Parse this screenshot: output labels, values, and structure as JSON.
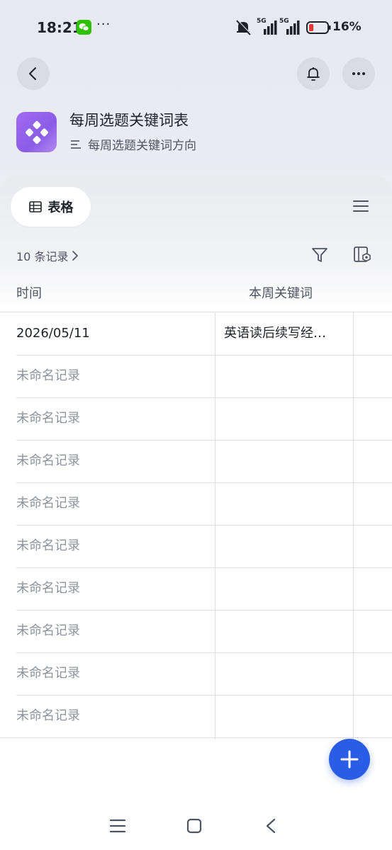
{
  "status_bar": {
    "time": "18:21",
    "more": "···",
    "signal_1_label": "5G",
    "signal_2_label": "5G",
    "battery_percent": "16%",
    "battery_level": 0.16,
    "icons": [
      "wechat-icon",
      "mute-icon",
      "signal-icon",
      "battery-icon"
    ]
  },
  "header": {
    "back_icon": "chevron-left-icon",
    "bell_icon": "bell-icon",
    "more_icon": "more-horizontal-icon",
    "app_title": "每周选题关键词表",
    "table_name": "每周选题关键词方向"
  },
  "toolbar": {
    "view_label": "表格",
    "record_count_label": "10 条记录",
    "menu_icon": "menu-icon",
    "filter_icon": "filter-icon",
    "settings_icon": "field-settings-icon"
  },
  "table": {
    "columns": [
      "时间",
      "本周关键词"
    ],
    "rows": [
      {
        "primary": "2026/05/11",
        "secondary": "英语读后续写经…",
        "named": true
      },
      {
        "primary": "未命名记录",
        "secondary": "",
        "named": false
      },
      {
        "primary": "未命名记录",
        "secondary": "",
        "named": false
      },
      {
        "primary": "未命名记录",
        "secondary": "",
        "named": false
      },
      {
        "primary": "未命名记录",
        "secondary": "",
        "named": false
      },
      {
        "primary": "未命名记录",
        "secondary": "",
        "named": false
      },
      {
        "primary": "未命名记录",
        "secondary": "",
        "named": false
      },
      {
        "primary": "未命名记录",
        "secondary": "",
        "named": false
      },
      {
        "primary": "未命名记录",
        "secondary": "",
        "named": false
      },
      {
        "primary": "未命名记录",
        "secondary": "",
        "named": false
      }
    ]
  },
  "fab": {
    "icon": "plus-icon"
  },
  "colors": {
    "accent": "#2a5ce6",
    "app_icon": "#9a66ee",
    "muted_text": "#8f959e",
    "battery_low": "#e53935"
  }
}
